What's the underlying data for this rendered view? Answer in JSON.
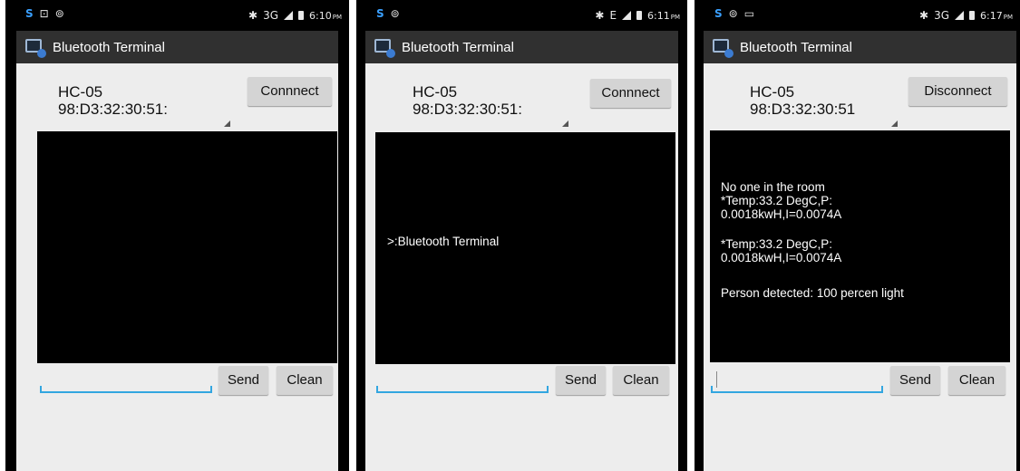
{
  "screens": [
    {
      "status": {
        "time": "6:10",
        "ampm": "PM",
        "network": "3G"
      },
      "app_title": "Bluetooth Terminal",
      "device": {
        "name": "HC-05",
        "address": "98:D3:32:30:51:"
      },
      "connect_label": "Connnect",
      "terminal_lines": [],
      "send_label": "Send",
      "clean_label": "Clean"
    },
    {
      "status": {
        "time": "6:11",
        "ampm": "PM",
        "network": "E"
      },
      "app_title": "Bluetooth Terminal",
      "device": {
        "name": "HC-05",
        "address": "98:D3:32:30:51:"
      },
      "connect_label": "Connnect",
      "terminal_lines": [
        ">:Bluetooth Terminal"
      ],
      "send_label": "Send",
      "clean_label": "Clean"
    },
    {
      "status": {
        "time": "6:17",
        "ampm": "PM",
        "network": "3G"
      },
      "app_title": "Bluetooth Terminal",
      "device": {
        "name": "HC-05",
        "address": "98:D3:32:30:51"
      },
      "connect_label": "Disconnect",
      "terminal_lines": [
        "No one in the room",
        "*Temp:33.2 DegC,P:",
        "0.0018kwH,I=0.0074A",
        "*Temp:33.2 DegC,P:",
        "0.0018kwH,I=0.0074A",
        "Person detected: 100 percen light"
      ],
      "send_label": "Send",
      "clean_label": "Clean"
    }
  ]
}
